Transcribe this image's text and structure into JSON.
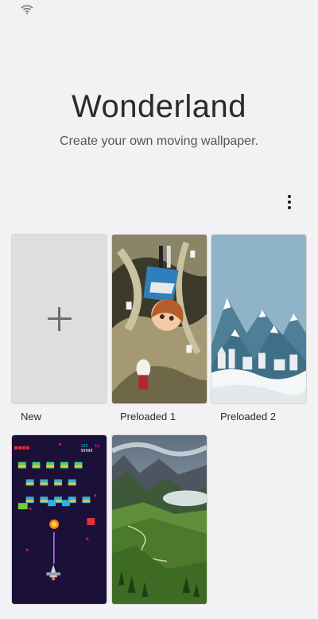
{
  "app": {
    "title": "Wonderland",
    "subtitle": "Create your own moving wallpaper."
  },
  "header": {
    "more_options_icon": "more-vert-icon"
  },
  "status_bar": {
    "wifi_icon": "wifi-icon"
  },
  "wallpapers": [
    {
      "label": "New",
      "kind": "new",
      "icon": "plus-icon"
    },
    {
      "label": "Preloaded 1",
      "kind": "preloaded",
      "art": "alice-falling"
    },
    {
      "label": "Preloaded 2",
      "kind": "preloaded",
      "art": "snowy-village"
    },
    {
      "label": "",
      "kind": "preloaded",
      "art": "space-invaders",
      "score": "193",
      "hi": "12",
      "counter": "99990"
    },
    {
      "label": "",
      "kind": "preloaded",
      "art": "mountain-valley"
    }
  ],
  "colors": {
    "background": "#f2f2f4",
    "new_tile": "#dedede"
  }
}
